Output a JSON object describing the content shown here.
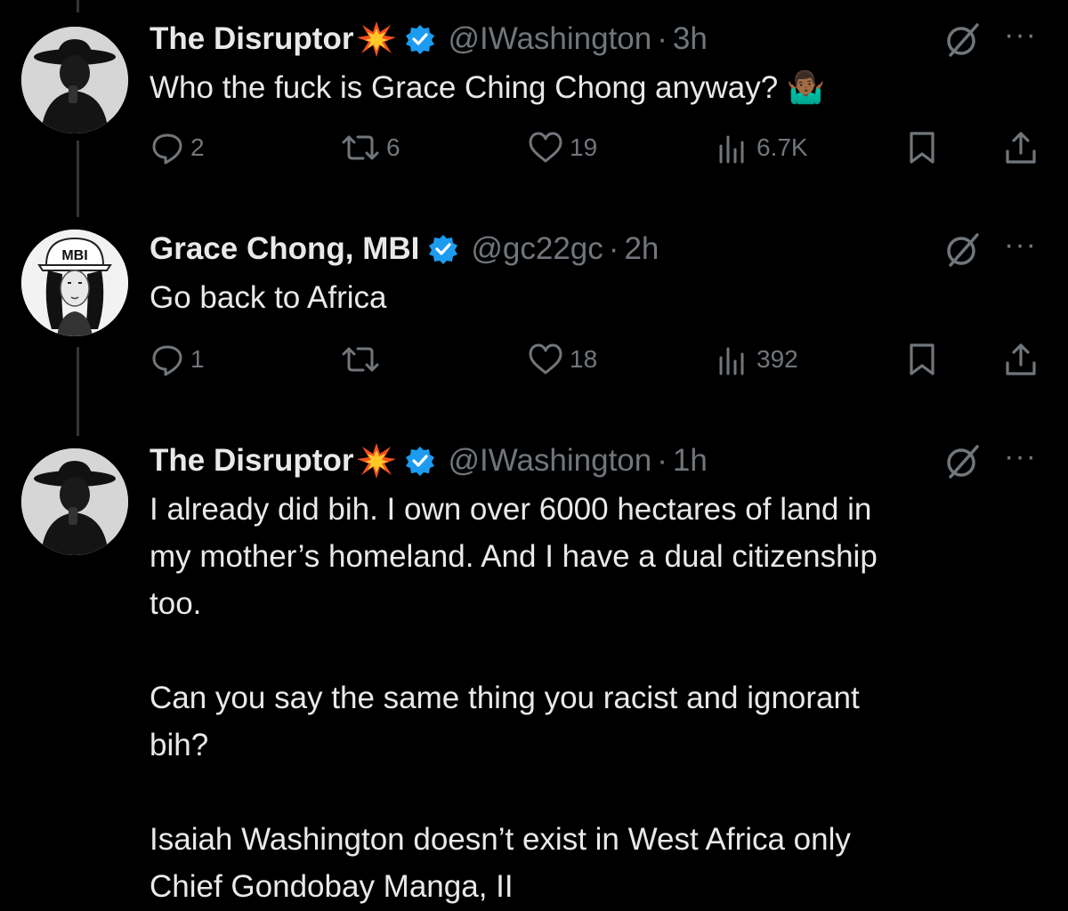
{
  "tweets": [
    {
      "name": "The Disruptor",
      "handle": "@IWashington",
      "time": "3h",
      "dot": "·",
      "text": "Who the fuck is Grace Ching Chong anyway? 🤷🏾‍♂️",
      "replies": "2",
      "reposts": "6",
      "likes": "19",
      "views": "6.7K"
    },
    {
      "name": "Grace Chong, MBI",
      "handle": "@gc22gc",
      "time": "2h",
      "dot": "·",
      "avatar_hat_text": "MBI",
      "text": "Go back to Africa",
      "replies": "1",
      "reposts": "",
      "likes": "18",
      "views": "392"
    },
    {
      "name": "The Disruptor",
      "handle": "@IWashington",
      "time": "1h",
      "dot": "·",
      "text_lines": [
        "I already did bih. I own over 6000 hectares of land in",
        "my mother’s homeland. And I have a dual citizenship",
        "too.",
        "",
        "Can you say the same thing you racist and ignorant",
        "bih?",
        "",
        "Isaiah Washington doesn’t exist in West Africa only",
        "Chief Gondobay Manga, II"
      ]
    }
  ],
  "more_label": "···",
  "colors": {
    "background": "#000000",
    "text": "#e7e9ea",
    "muted": "#71767b",
    "verified": "#1d9bf0",
    "emoji_burst": "#f4511e"
  },
  "icons": [
    "collision-emoji-icon",
    "verified-badge-icon",
    "grok-icon",
    "more-icon",
    "reply-icon",
    "repost-icon",
    "like-icon",
    "views-icon",
    "bookmark-icon",
    "share-icon"
  ]
}
